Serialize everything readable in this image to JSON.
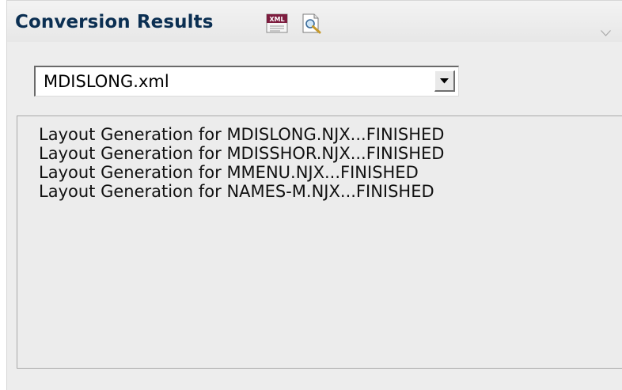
{
  "panel": {
    "title": "Conversion Results",
    "icons": {
      "xml": "xml-file-icon",
      "preview": "print-preview-icon",
      "collapse": "chevron-down-icon"
    }
  },
  "file_select": {
    "selected": "MDISLONG.xml"
  },
  "results": {
    "lines": [
      "Layout Generation for MDISLONG.NJX...FINISHED",
      "Layout Generation for MDISSHOR.NJX...FINISHED",
      "Layout Generation for MMENU.NJX...FINISHED",
      "Layout Generation for NAMES-M.NJX...FINISHED"
    ]
  },
  "colors": {
    "title": "#0b2f52",
    "panel_background": "#ededed",
    "box_border": "#a9a9a9"
  }
}
